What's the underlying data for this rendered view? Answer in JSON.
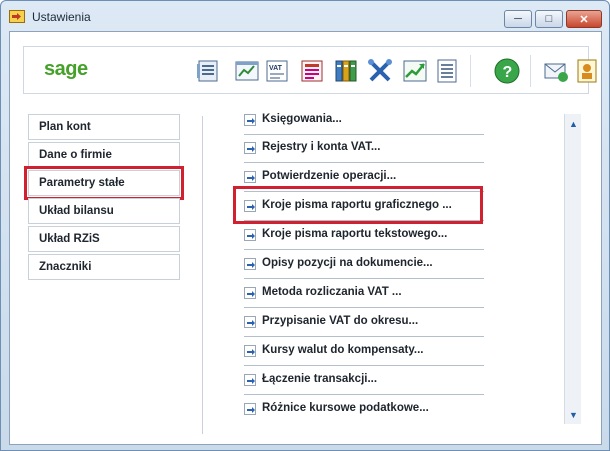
{
  "window": {
    "title": "Ustawienia",
    "minimize_glyph": "─",
    "maximize_glyph": "□",
    "close_glyph": "✕"
  },
  "toolbar": {
    "logo_text": "sage",
    "icons": [
      "document-list-icon",
      "chart-icon",
      "vat-document-icon",
      "tax-form-icon",
      "binders-icon",
      "tools-icon",
      "growth-chart-icon",
      "ledger-icon",
      "help-icon",
      "email-icon",
      "user-icon"
    ]
  },
  "nav": {
    "items": [
      {
        "label": "Plan kont",
        "selected": false
      },
      {
        "label": "Dane o firmie",
        "selected": false
      },
      {
        "label": "Parametry stałe",
        "selected": true
      },
      {
        "label": "Układ bilansu",
        "selected": false
      },
      {
        "label": "Układ RZiS",
        "selected": false
      },
      {
        "label": "Znaczniki",
        "selected": false
      }
    ]
  },
  "settings_list": {
    "items": [
      {
        "label": "Księgowania..."
      },
      {
        "label": "Rejestry i konta VAT..."
      },
      {
        "label": "Potwierdzenie operacji..."
      },
      {
        "label": "Kroje pisma raportu graficznego ...",
        "highlighted": true
      },
      {
        "label": "Kroje pisma raportu tekstowego..."
      },
      {
        "label": "Opisy pozycji na dokumencie..."
      },
      {
        "label": "Metoda rozliczania VAT ..."
      },
      {
        "label": "Przypisanie VAT do okresu..."
      },
      {
        "label": "Kursy walut do kompensaty..."
      },
      {
        "label": "Łączenie transakcji..."
      },
      {
        "label": "Różnice kursowe podatkowe..."
      }
    ]
  },
  "scrollbar": {
    "up_glyph": "▲",
    "down_glyph": "▼",
    "scroll_position": 0.1
  },
  "colors": {
    "highlight_red": "#d1202f",
    "sage_green": "#45a12a"
  }
}
